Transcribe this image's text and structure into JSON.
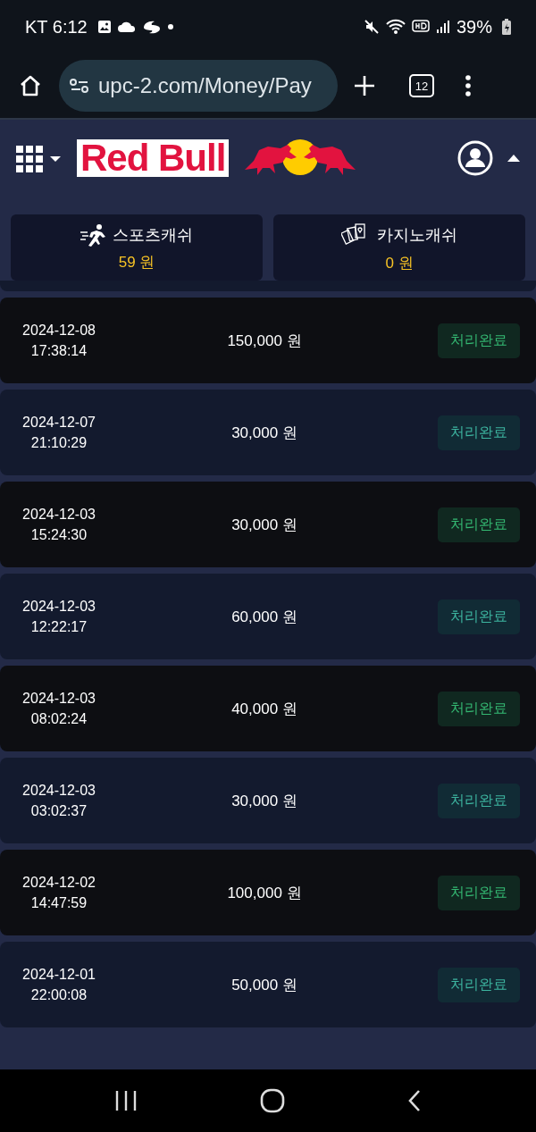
{
  "status_bar": {
    "carrier_time": "KT 6:12",
    "battery": "39%"
  },
  "browser": {
    "url": "upc-2.com/Money/Pay",
    "tab_count": "12"
  },
  "header": {
    "logo_text": "Red Bull"
  },
  "wallets": [
    {
      "kind": "sports",
      "label": "스포츠캐쉬",
      "amount": "59 원"
    },
    {
      "kind": "casino",
      "label": "카지노캐쉬",
      "amount": "0 원"
    }
  ],
  "rows": [
    {
      "date": "2024-12-08",
      "time": "17:38:14",
      "amount": "150,000 원",
      "status": "처리완료"
    },
    {
      "date": "2024-12-07",
      "time": "21:10:29",
      "amount": "30,000 원",
      "status": "처리완료"
    },
    {
      "date": "2024-12-03",
      "time": "15:24:30",
      "amount": "30,000 원",
      "status": "처리완료"
    },
    {
      "date": "2024-12-03",
      "time": "12:22:17",
      "amount": "60,000 원",
      "status": "처리완료"
    },
    {
      "date": "2024-12-03",
      "time": "08:02:24",
      "amount": "40,000 원",
      "status": "처리완료"
    },
    {
      "date": "2024-12-03",
      "time": "03:02:37",
      "amount": "30,000 원",
      "status": "처리완료"
    },
    {
      "date": "2024-12-02",
      "time": "14:47:59",
      "amount": "100,000 원",
      "status": "처리완료"
    },
    {
      "date": "2024-12-01",
      "time": "22:00:08",
      "amount": "50,000 원",
      "status": "처리완료"
    }
  ]
}
